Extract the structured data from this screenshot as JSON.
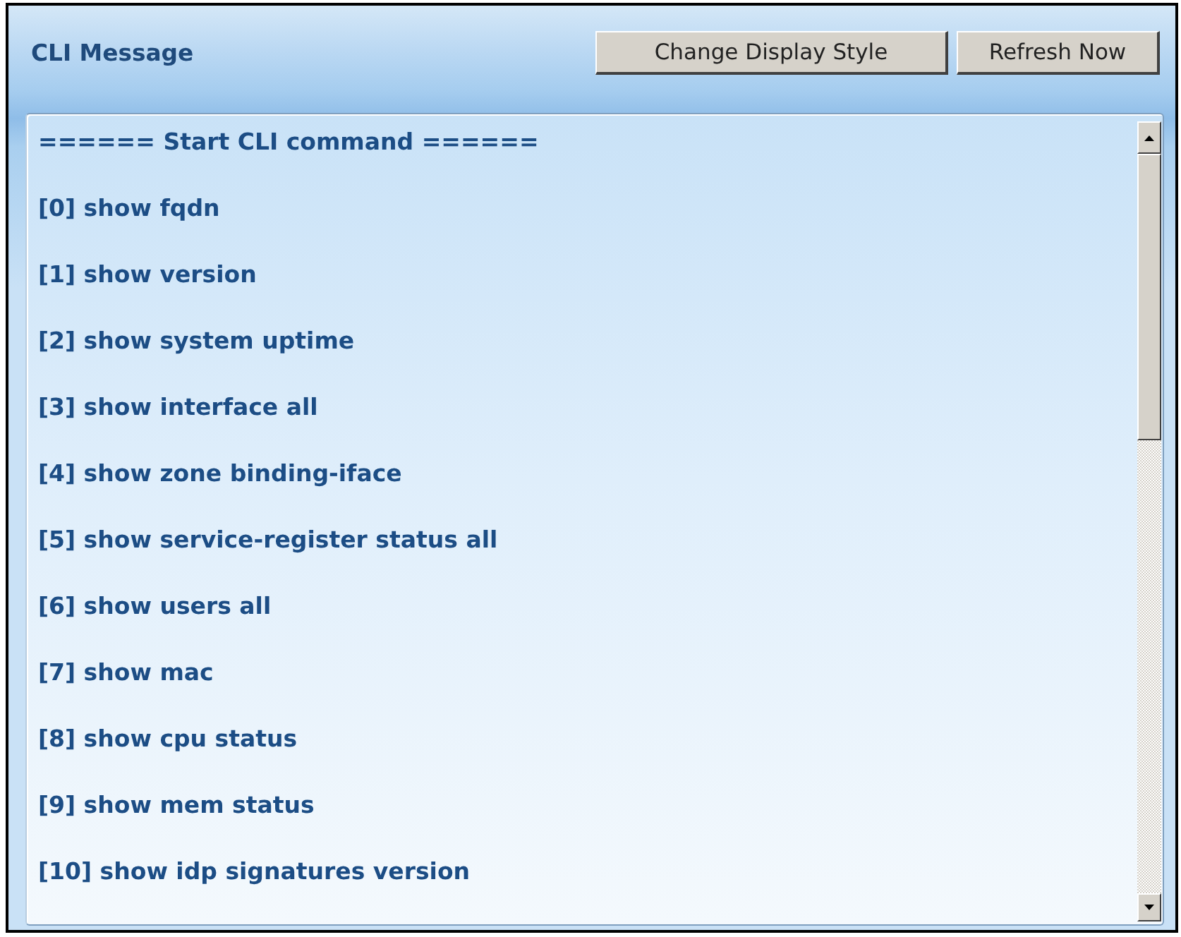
{
  "panel": {
    "title": "CLI Message",
    "buttons": [
      "Change Display Style",
      "Refresh Now"
    ]
  },
  "output": {
    "lines": [
      "====== Start CLI command ======",
      "[0] show fqdn",
      "[1] show version",
      "[2] show system uptime",
      "[3] show interface all",
      "[4] show zone binding-iface",
      "[5] show service-register status all",
      "[6] show users all",
      "[7] show mac",
      "[8] show cpu status",
      "[9] show mem status",
      "[10] show idp signatures version"
    ]
  }
}
